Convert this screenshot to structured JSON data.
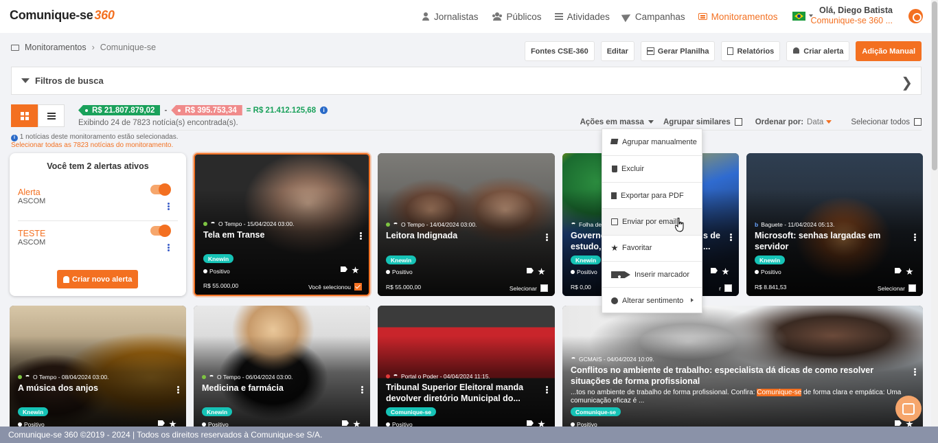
{
  "app": {
    "logo_text": "Comunique-se",
    "logo_number": "360"
  },
  "nav": {
    "items": [
      {
        "label": "Jornalistas",
        "icon": "user-icon"
      },
      {
        "label": "Públicos",
        "icon": "users-icon"
      },
      {
        "label": "Atividades",
        "icon": "list-icon"
      },
      {
        "label": "Campanhas",
        "icon": "paper-plane-icon"
      },
      {
        "label": "Monitoramentos",
        "icon": "monitor-icon",
        "active": true
      }
    ]
  },
  "user": {
    "greeting": "Olá, Diego Batista",
    "company": "Comunique-se 360 ..."
  },
  "breadcrumb": {
    "root": "Monitoramentos",
    "current": "Comunique-se"
  },
  "toolbar": {
    "fontes": "Fontes CSE-360",
    "editar": "Editar",
    "gerar_planilha": "Gerar Planilha",
    "relatorios": "Relatórios",
    "criar_alerta": "Criar alerta",
    "adicao_manual": "Adição Manual"
  },
  "filters": {
    "label": "Filtros de busca"
  },
  "totals": {
    "positive": "R$ 21.807.879,02",
    "minus": "-",
    "negative": "R$ 395.753,34",
    "result": "= R$ 21.412.125,68",
    "info_icon": "i"
  },
  "results": {
    "showing": "Exibindo 24 de 7823 notícia(s) encontrada(s)."
  },
  "selection": {
    "info": "1 notícias deste monitoramento estão selecionadas.",
    "select_all_link": "Selecionar todas as 7823 notícias do monitoramento."
  },
  "tools": {
    "acoes": "Ações em massa",
    "agrupar": "Agrupar similares",
    "ordenar": "Ordenar por:",
    "ordenar_value": "Data",
    "selecionar_todos": "Selecionar todos"
  },
  "alerts": {
    "title": "Você tem 2 alertas ativos",
    "items": [
      {
        "title": "Alerta",
        "subtitle": "ASCOM",
        "active": true
      },
      {
        "title": "TESTE",
        "subtitle": "ASCOM",
        "active": true
      }
    ],
    "new_button": "Criar novo alerta"
  },
  "mass_menu": {
    "items": [
      {
        "label": "Agrupar manualmente",
        "icon": "layers-icon"
      },
      {
        "label": "Excluir",
        "icon": "trash-icon"
      },
      {
        "label": "Exportar para PDF",
        "icon": "file-icon"
      },
      {
        "label": "Enviar por email",
        "icon": "mail-icon"
      },
      {
        "label": "Favoritar",
        "icon": "star-icon"
      },
      {
        "label": "Inserir marcador",
        "icon": "tag-icon"
      },
      {
        "label": "Alterar sentimento",
        "icon": "smile-icon"
      }
    ]
  },
  "cards": [
    {
      "source": "O Tempo - 15/04/2024 03:00.",
      "title": "Tela em Transe",
      "tag": "Knewin",
      "sentiment": "Positivo",
      "value": "R$ 55.000,00",
      "select_label": "Você selecionou",
      "selected": true
    },
    {
      "source": "O Tempo - 14/04/2024 03:00.",
      "title": "Leitora Indignada",
      "tag": "Knewin",
      "sentiment": "Positivo",
      "value": "R$ 55.000,00",
      "select_label": "Selecionar",
      "selected": false
    },
    {
      "source": "Folha de",
      "title": "Governo",
      "title_right": "s de",
      "title2_left": "estudo,",
      "title2_right": "...",
      "tag": "Knewin",
      "sentiment": "Positivo",
      "value": "R$ 0,00",
      "select_label": "r",
      "selected": false
    },
    {
      "source": "Baguete - 11/04/2024 05:13.",
      "title": "Microsoft: senhas largadas em servidor",
      "tag": "Knewin",
      "sentiment": "Positivo",
      "value": "R$ 8.841,53",
      "select_label": "Selecionar",
      "selected": false
    },
    {
      "source": "O Tempo - 08/04/2024 03:00.",
      "title": "A música dos anjos",
      "tag": "Knewin",
      "sentiment": "Positivo"
    },
    {
      "source": "O Tempo - 06/04/2024 03:00.",
      "title": "Medicina e farmácia",
      "tag": "Knewin",
      "sentiment": "Positivo"
    },
    {
      "source": "Portal o Poder - 04/04/2024 11:15.",
      "title": "Tribunal Superior Eleitoral manda devolver diretório Municipal do...",
      "tag": "Comunique-se",
      "sentiment": "Positivo"
    },
    {
      "source": "GCMAIS - 04/04/2024 10:09.",
      "title": "Conflitos no ambiente de trabalho: especialista dá dicas de como resolver situações de forma profissional",
      "summary_pre": "...tos no ambiente de trabalho de forma profissional. Confira: ",
      "summary_hl": "Comunique-se",
      "summary_post": " de forma clara e empática: Uma comunicação eficaz é ...",
      "tag": "Comunique-se",
      "sentiment": "Positivo"
    }
  ],
  "footer": {
    "text": "Comunique-se 360 ©2019 - 2024 | Todos os direitos reservados à Comunique-se S/A."
  },
  "colors": {
    "accent": "#f37021",
    "positive": "#1aa15b",
    "negative": "#f08b8b",
    "tag": "#16c3b6"
  }
}
